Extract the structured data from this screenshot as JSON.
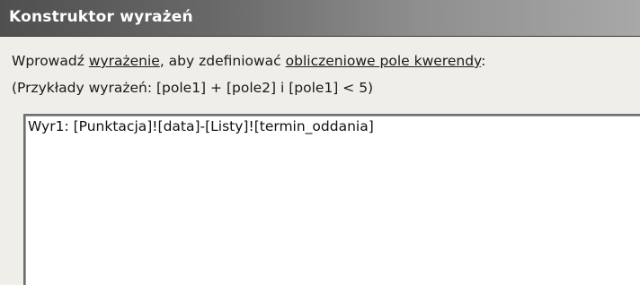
{
  "window": {
    "title": "Konstruktor wyrażeń"
  },
  "instructions": {
    "line1_part1": "Wprowadź ",
    "line1_link1": "wyrażenie",
    "line1_part2": ", aby zdefiniować ",
    "line1_link2": "obliczeniowe pole kwerendy",
    "line1_part3": ":",
    "line2": "(Przykłady wyrażeń: [pole1] + [pole2] i [pole1] < 5)"
  },
  "expression": {
    "value": "Wyr1: [Punktacja]![data]-[Listy]![termin_oddania]"
  }
}
